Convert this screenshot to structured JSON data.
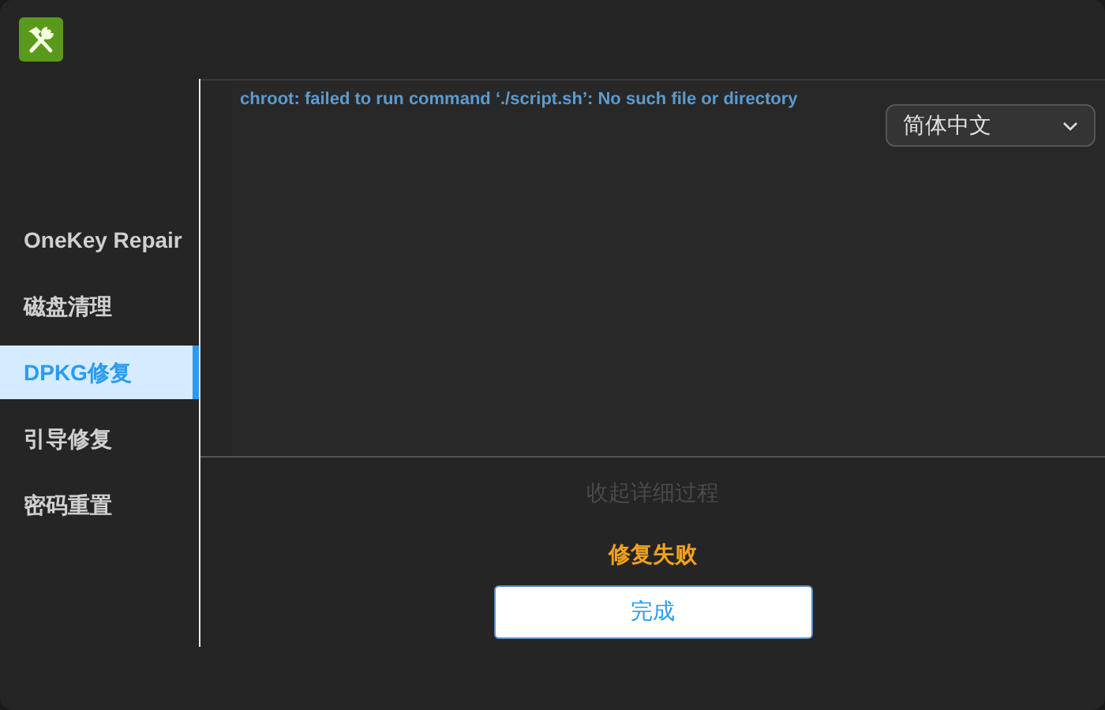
{
  "sidebar": {
    "items": [
      {
        "label": "OneKey Repair",
        "selected": false
      },
      {
        "label": "磁盘清理",
        "selected": false
      },
      {
        "label": "DPKG修复",
        "selected": true
      },
      {
        "label": "引导修复",
        "selected": false
      },
      {
        "label": "密码重置",
        "selected": false
      }
    ]
  },
  "log": {
    "lines": [
      "chroot: failed to run command ‘./script.sh’: No such file or directory"
    ]
  },
  "language_select": {
    "value": "简体中文"
  },
  "toggle_details": "收起详细过程",
  "status": {
    "text": "修复失败",
    "kind": "error"
  },
  "done_button": "完成"
}
